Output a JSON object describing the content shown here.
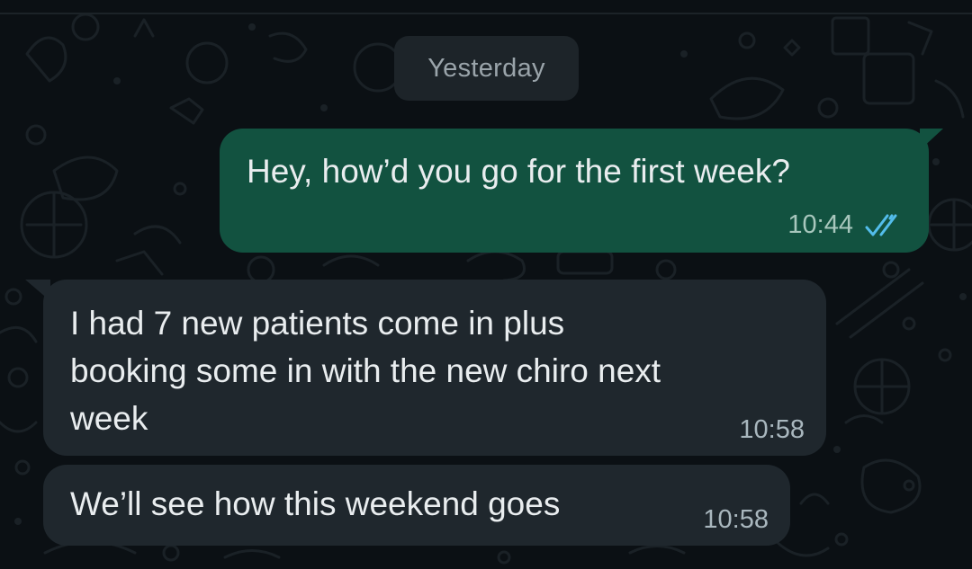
{
  "date_divider": {
    "label": "Yesterday"
  },
  "messages": [
    {
      "direction": "outgoing",
      "text": "Hey, how’d you go for the first week?",
      "time": "10:44",
      "status_icon": "double-check-read-icon"
    },
    {
      "direction": "incoming",
      "text": "I had 7 new patients come in plus\nbooking some in with the new chiro next\nweek",
      "time": "10:58"
    },
    {
      "direction": "incoming",
      "text": "We’ll see how this weekend goes",
      "time": "10:58"
    }
  ],
  "colors": {
    "background": "#0b1014",
    "outgoing_bubble": "#125240",
    "incoming_bubble": "#1f272d",
    "read_ticks": "#53bdeb",
    "date_chip": "#1d2429"
  }
}
